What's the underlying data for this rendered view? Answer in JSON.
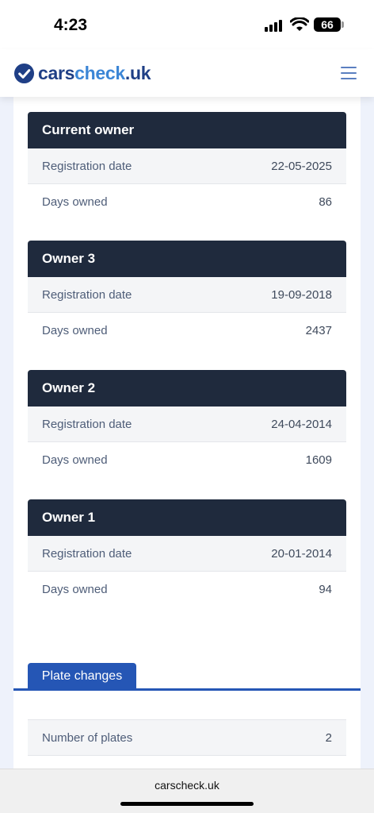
{
  "status": {
    "time": "4:23",
    "battery": "66"
  },
  "header": {
    "brand_a": "cars",
    "brand_b": "check",
    "brand_c": ".uk"
  },
  "owners": [
    {
      "title": "Current owner",
      "reg_label": "Registration date",
      "reg_value": "22-05-2025",
      "days_label": "Days owned",
      "days_value": "86"
    },
    {
      "title": "Owner 3",
      "reg_label": "Registration date",
      "reg_value": "19-09-2018",
      "days_label": "Days owned",
      "days_value": "2437"
    },
    {
      "title": "Owner 2",
      "reg_label": "Registration date",
      "reg_value": "24-04-2014",
      "days_label": "Days owned",
      "days_value": "1609"
    },
    {
      "title": "Owner 1",
      "reg_label": "Registration date",
      "reg_value": "20-01-2014",
      "days_label": "Days owned",
      "days_value": "94"
    }
  ],
  "plates": {
    "tab_label": "Plate changes",
    "label": "Number of plates",
    "value": "2"
  },
  "browser": {
    "url": "carscheck.uk"
  },
  "colors": {
    "header_dark": "#1f2a3d",
    "accent": "#2556b5",
    "brand_dark": "#1f3f86",
    "brand_light": "#3c86d6"
  }
}
